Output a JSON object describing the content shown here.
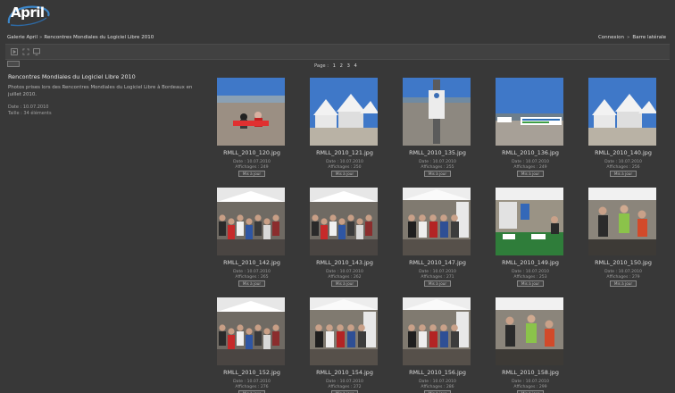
{
  "header": {
    "logo_text": "April"
  },
  "breadcrumb": {
    "home": "Galerie April",
    "separator": "»",
    "current": "Rencontres Mondiales du Logiciel Libre 2010"
  },
  "user_links": {
    "login": "Connexion",
    "separator": "»",
    "sidebar": "Barre latérale"
  },
  "toolbar": {
    "icons": [
      "slideshow-icon",
      "fullscreen-icon",
      "monitor-icon"
    ]
  },
  "album": {
    "title": "Rencontres Mondiales du Logiciel Libre 2010",
    "description": "Photos prises lors des Rencontres Mondiales du Logiciel Libre à Bordeaux en juillet 2010.",
    "date": "Date : 10.07.2010",
    "size": "Taille : 34 éléments"
  },
  "pager": {
    "label": "Page :",
    "pages": [
      "1",
      "2",
      "3",
      "4"
    ]
  },
  "thumbnails": [
    {
      "name": "RMLL_2010_120.jpg",
      "date": "Date : 10.07.2010",
      "views": "Affichages : 249",
      "button": "Mis à jour",
      "scene": "quay"
    },
    {
      "name": "RMLL_2010_121.jpg",
      "date": "Date : 10.07.2010",
      "views": "Affichages : 250",
      "button": "Mis à jour",
      "scene": "tents"
    },
    {
      "name": "RMLL_2010_135.jpg",
      "date": "Date : 10.07.2010",
      "views": "Affichages : 255",
      "button": "Mis à jour",
      "scene": "pole"
    },
    {
      "name": "RMLL_2010_136.jpg",
      "date": "Date : 10.07.2010",
      "views": "Affichages : 249",
      "button": "Mis à jour",
      "scene": "banner"
    },
    {
      "name": "RMLL_2010_140.jpg",
      "date": "Date : 10.07.2010",
      "views": "Affichages : 256",
      "button": "Mis à jour",
      "scene": "tents"
    },
    {
      "name": "RMLL_2010_142.jpg",
      "date": "Date : 10.07.2010",
      "views": "Affichages : 265",
      "button": "Mis à jour",
      "scene": "crowd"
    },
    {
      "name": "RMLL_2010_143.jpg",
      "date": "Date : 10.07.2010",
      "views": "Affichages : 262",
      "button": "Mis à jour",
      "scene": "crowd"
    },
    {
      "name": "RMLL_2010_147.jpg",
      "date": "Date : 10.07.2010",
      "views": "Affichages : 271",
      "button": "Mis à jour",
      "scene": "stand"
    },
    {
      "name": "RMLL_2010_149.jpg",
      "date": "Date : 10.07.2010",
      "views": "Affichages : 253",
      "button": "Mis à jour",
      "scene": "table"
    },
    {
      "name": "RMLL_2010_150.jpg",
      "date": "Date : 10.07.2010",
      "views": "Affichages : 279",
      "button": "Mis à jour",
      "scene": "people"
    },
    {
      "name": "RMLL_2010_152.jpg",
      "date": "Date : 10.07.2010",
      "views": "Affichages : 276",
      "button": "Mis à jour",
      "scene": "crowd"
    },
    {
      "name": "RMLL_2010_154.jpg",
      "date": "Date : 10.07.2010",
      "views": "Affichages : 272",
      "button": "Mis à jour",
      "scene": "stand"
    },
    {
      "name": "RMLL_2010_156.jpg",
      "date": "Date : 10.07.2010",
      "views": "Affichages : 286",
      "button": "Mis à jour",
      "scene": "stand"
    },
    {
      "name": "RMLL_2010_158.jpg",
      "date": "Date : 10.07.2010",
      "views": "Affichages : 299",
      "button": "Mis à jour",
      "scene": "people"
    }
  ],
  "colors": {
    "background": "#383838",
    "toolbar": "#414141",
    "text": "#cfcfcf",
    "sky": "#3f78c8",
    "tent": "#f2f2f2",
    "grass": "#2f7d3a"
  }
}
